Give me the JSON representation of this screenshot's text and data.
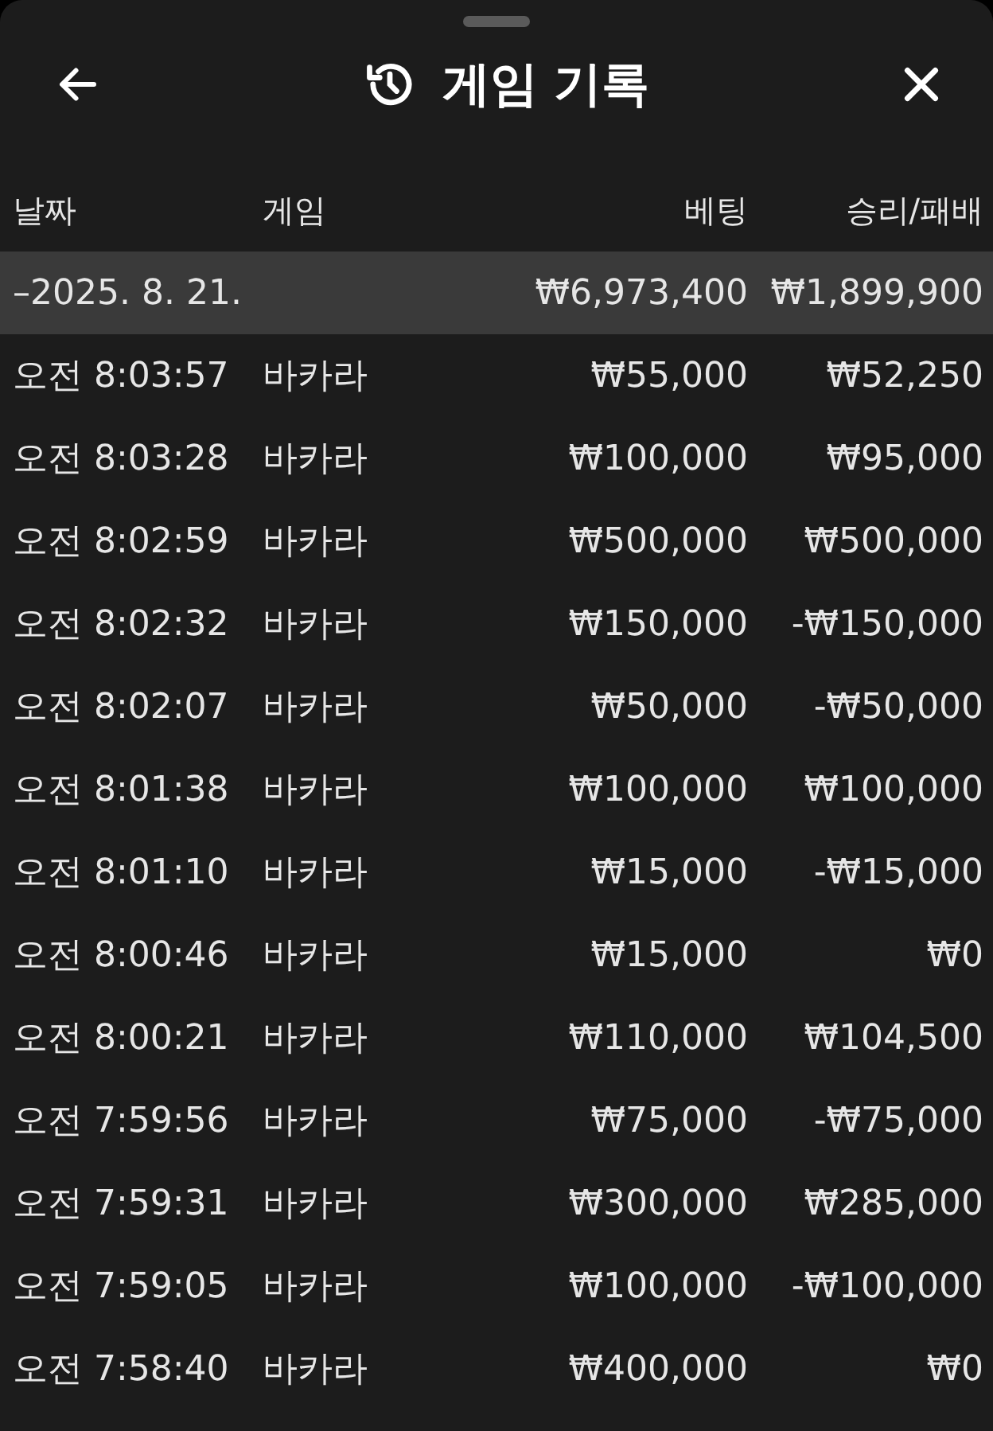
{
  "header": {
    "title": "게임 기록"
  },
  "columns": [
    "날짜",
    "게임",
    "베팅",
    "승리/패배"
  ],
  "group": {
    "date": "–2025. 8. 21.",
    "bet": "₩6,973,400",
    "result": "₩1,899,900"
  },
  "rows": [
    {
      "time": "오전 8:03:57",
      "game": "바카라",
      "bet": "₩55,000",
      "result": "₩52,250"
    },
    {
      "time": "오전 8:03:28",
      "game": "바카라",
      "bet": "₩100,000",
      "result": "₩95,000"
    },
    {
      "time": "오전 8:02:59",
      "game": "바카라",
      "bet": "₩500,000",
      "result": "₩500,000"
    },
    {
      "time": "오전 8:02:32",
      "game": "바카라",
      "bet": "₩150,000",
      "result": "-₩150,000"
    },
    {
      "time": "오전 8:02:07",
      "game": "바카라",
      "bet": "₩50,000",
      "result": "-₩50,000"
    },
    {
      "time": "오전 8:01:38",
      "game": "바카라",
      "bet": "₩100,000",
      "result": "₩100,000"
    },
    {
      "time": "오전 8:01:10",
      "game": "바카라",
      "bet": "₩15,000",
      "result": "-₩15,000"
    },
    {
      "time": "오전 8:00:46",
      "game": "바카라",
      "bet": "₩15,000",
      "result": "₩0"
    },
    {
      "time": "오전 8:00:21",
      "game": "바카라",
      "bet": "₩110,000",
      "result": "₩104,500"
    },
    {
      "time": "오전 7:59:56",
      "game": "바카라",
      "bet": "₩75,000",
      "result": "-₩75,000"
    },
    {
      "time": "오전 7:59:31",
      "game": "바카라",
      "bet": "₩300,000",
      "result": "₩285,000"
    },
    {
      "time": "오전 7:59:05",
      "game": "바카라",
      "bet": "₩100,000",
      "result": "-₩100,000"
    },
    {
      "time": "오전 7:58:40",
      "game": "바카라",
      "bet": "₩400,000",
      "result": "₩0"
    }
  ]
}
